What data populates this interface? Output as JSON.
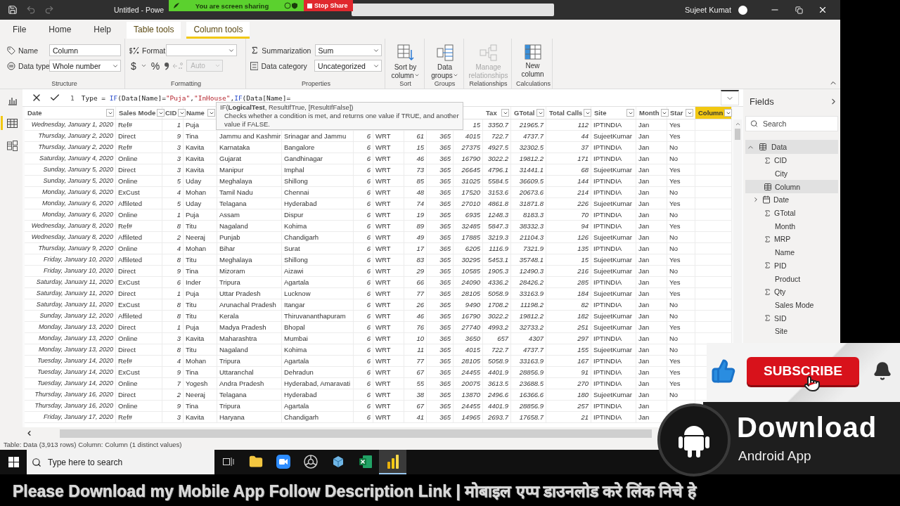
{
  "title_bar": {
    "title": "Untitled - Powe",
    "user": "Sujeet Kumat",
    "undo_disabled": true,
    "redo_disabled": true
  },
  "screen_share": {
    "status": "You are screen sharing",
    "stop_button": "Stop Share"
  },
  "ribbon_tabs": [
    {
      "label": "File",
      "selected": false,
      "kind": "plain"
    },
    {
      "label": "Home",
      "selected": false,
      "kind": "plain"
    },
    {
      "label": "Help",
      "selected": false,
      "kind": "plain"
    },
    {
      "label": "Table tools",
      "selected": false,
      "kind": "contextual"
    },
    {
      "label": "Column tools",
      "selected": true,
      "kind": "contextual"
    }
  ],
  "ribbon": {
    "structure": {
      "label": "Structure",
      "name_label": "Name",
      "name_value": "Column",
      "data_type_label": "Data type",
      "data_type_value": "Whole number"
    },
    "formatting": {
      "label": "Formatting",
      "format_label": "Format",
      "currency": "$",
      "percent": "%",
      "decimals_value": "Auto",
      "decimals_disabled": true
    },
    "properties": {
      "label": "Properties",
      "summarization_label": "Summarization",
      "summarization_value": "Sum",
      "data_category_label": "Data category",
      "data_category_value": "Uncategorized"
    },
    "sort": {
      "label": "Sort",
      "button": "Sort by column"
    },
    "groups": {
      "label": "Groups",
      "button": "Data groups"
    },
    "relationships": {
      "label": "Relationships",
      "button": "Manage relationships",
      "disabled": true
    },
    "calculations": {
      "label": "Calculations",
      "button": "New column"
    }
  },
  "view_rail": [
    {
      "kind": "report",
      "selected": false
    },
    {
      "kind": "data",
      "selected": true
    },
    {
      "kind": "model",
      "selected": false
    }
  ],
  "formula_bar": {
    "line_number": "1",
    "tokens": [
      {
        "text": "Type = ",
        "kind": "plain"
      },
      {
        "text": "IF",
        "kind": "function"
      },
      {
        "text": "(Data[Name]=",
        "kind": "plain"
      },
      {
        "text": "\"Puja\"",
        "kind": "string"
      },
      {
        "text": ",",
        "kind": "plain"
      },
      {
        "text": "\"InHouse\"",
        "kind": "string"
      },
      {
        "text": ",",
        "kind": "plain"
      },
      {
        "text": "IF",
        "kind": "function"
      },
      {
        "text": "(Data[Name]=",
        "kind": "plain"
      }
    ]
  },
  "tooltip": {
    "signature": "IF(**LogicalTest**, ResultIfTrue, [ResultIfFalse])",
    "description": "Checks whether a condition is met, and returns one value if TRUE, and another value if FALSE."
  },
  "table": {
    "columns": [
      {
        "label": "Date",
        "kind": "date",
        "selected": false
      },
      {
        "label": "Sales Mode",
        "kind": "text",
        "selected": false
      },
      {
        "label": "CID",
        "kind": "number",
        "selected": false
      },
      {
        "label": "Name",
        "kind": "text",
        "selected": false
      },
      {
        "kind": "text"
      },
      {
        "kind": "text"
      },
      {
        "kind": "number"
      },
      {
        "kind": "text"
      },
      {
        "kind": "number"
      },
      {
        "kind": "number"
      },
      {
        "kind": "number"
      },
      {
        "label": "Tax",
        "kind": "number",
        "selected": false
      },
      {
        "label": "GTotal",
        "kind": "number",
        "selected": false
      },
      {
        "label": "Total Calls",
        "kind": "number",
        "selected": false
      },
      {
        "label": "Site",
        "kind": "text",
        "selected": false
      },
      {
        "label": "Month",
        "kind": "text",
        "selected": false
      },
      {
        "label": "Star",
        "kind": "text",
        "selected": false
      },
      {
        "label": "Column",
        "kind": "text",
        "selected": true
      }
    ],
    "rows": [
      [
        "Wednesday, January 1, 2020",
        "Ref#",
        "1",
        "Puja",
        null,
        null,
        null,
        null,
        null,
        null,
        "15",
        "3350.7",
        "21965.7",
        "112",
        "IPTINDIA",
        "Jan",
        "Yes"
      ],
      [
        "Thursday, January 2, 2020",
        "Direct",
        "9",
        "Tina",
        "Jammu and Kashmir",
        "Srinagar and Jammu",
        "6",
        "WRT",
        "61",
        "365",
        "4015",
        "722.7",
        "4737.7",
        "44",
        "SujeetKumar",
        "Jan",
        "Yes"
      ],
      [
        "Thursday, January 2, 2020",
        "Ref#",
        "3",
        "Kavita",
        "Karnataka",
        "Bangalore",
        "6",
        "WRT",
        "15",
        "365",
        "27375",
        "4927.5",
        "32302.5",
        "37",
        "IPTINDIA",
        "Jan",
        "No"
      ],
      [
        "Saturday, January 4, 2020",
        "Online",
        "3",
        "Kavita",
        "Gujarat",
        "Gandhinagar",
        "6",
        "WRT",
        "46",
        "365",
        "16790",
        "3022.2",
        "19812.2",
        "171",
        "IPTINDIA",
        "Jan",
        "No"
      ],
      [
        "Sunday, January 5, 2020",
        "Direct",
        "3",
        "Kavita",
        "Manipur",
        "Imphal",
        "6",
        "WRT",
        "73",
        "365",
        "26645",
        "4796.1",
        "31441.1",
        "68",
        "SujeetKumar",
        "Jan",
        "Yes"
      ],
      [
        "Sunday, January 5, 2020",
        "Online",
        "5",
        "Uday",
        "Meghalaya",
        "Shillong",
        "6",
        "WRT",
        "85",
        "365",
        "31025",
        "5584.5",
        "36609.5",
        "144",
        "IPTINDIA",
        "Jan",
        "Yes"
      ],
      [
        "Monday, January 6, 2020",
        "ExCust",
        "4",
        "Mohan",
        "Tamil Nadu",
        "Chennai",
        "6",
        "WRT",
        "48",
        "365",
        "17520",
        "3153.6",
        "20673.6",
        "214",
        "IPTINDIA",
        "Jan",
        "No"
      ],
      [
        "Monday, January 6, 2020",
        "Affileted",
        "5",
        "Uday",
        "Telagana",
        "Hyderabad",
        "6",
        "WRT",
        "74",
        "365",
        "27010",
        "4861.8",
        "31871.8",
        "226",
        "SujeetKumar",
        "Jan",
        "Yes"
      ],
      [
        "Monday, January 6, 2020",
        "Online",
        "1",
        "Puja",
        "Assam",
        "Dispur",
        "6",
        "WRT",
        "19",
        "365",
        "6935",
        "1248.3",
        "8183.3",
        "70",
        "IPTINDIA",
        "Jan",
        "No"
      ],
      [
        "Wednesday, January 8, 2020",
        "Ref#",
        "8",
        "Titu",
        "Nagaland",
        "Kohima",
        "6",
        "WRT",
        "89",
        "365",
        "32485",
        "5847.3",
        "38332.3",
        "94",
        "IPTINDIA",
        "Jan",
        "Yes"
      ],
      [
        "Wednesday, January 8, 2020",
        "Affileted",
        "2",
        "Neeraj",
        "Punjab",
        "Chandigarh",
        "6",
        "WRT",
        "49",
        "365",
        "17885",
        "3219.3",
        "21104.3",
        "126",
        "SujeetKumar",
        "Jan",
        "No"
      ],
      [
        "Thursday, January 9, 2020",
        "Online",
        "4",
        "Mohan",
        "Bihar",
        "Surat",
        "6",
        "WRT",
        "17",
        "365",
        "6205",
        "1116.9",
        "7321.9",
        "135",
        "IPTINDIA",
        "Jan",
        "No"
      ],
      [
        "Friday, January 10, 2020",
        "Affileted",
        "8",
        "Titu",
        "Meghalaya",
        "Shillong",
        "6",
        "WRT",
        "83",
        "365",
        "30295",
        "5453.1",
        "35748.1",
        "15",
        "SujeetKumar",
        "Jan",
        "Yes"
      ],
      [
        "Friday, January 10, 2020",
        "Direct",
        "9",
        "Tina",
        "Mizoram",
        "Aizawi",
        "6",
        "WRT",
        "29",
        "365",
        "10585",
        "1905.3",
        "12490.3",
        "216",
        "SujeetKumar",
        "Jan",
        "No"
      ],
      [
        "Saturday, January 11, 2020",
        "ExCust",
        "6",
        "Inder",
        "Tripura",
        "Agartala",
        "6",
        "WRT",
        "66",
        "365",
        "24090",
        "4336.2",
        "28426.2",
        "285",
        "IPTINDIA",
        "Jan",
        "Yes"
      ],
      [
        "Saturday, January 11, 2020",
        "Direct",
        "1",
        "Puja",
        "Uttar Pradesh",
        "Lucknow",
        "6",
        "WRT",
        "77",
        "365",
        "28105",
        "5058.9",
        "33163.9",
        "184",
        "SujeetKumar",
        "Jan",
        "Yes"
      ],
      [
        "Saturday, January 11, 2020",
        "ExCust",
        "8",
        "Titu",
        "Arunachal Pradesh",
        "Itangar",
        "6",
        "WRT",
        "26",
        "365",
        "9490",
        "1708.2",
        "11198.2",
        "82",
        "IPTINDIA",
        "Jan",
        "No"
      ],
      [
        "Sunday, January 12, 2020",
        "Affileted",
        "8",
        "Titu",
        "Kerala",
        "Thiruvananthapuram",
        "6",
        "WRT",
        "46",
        "365",
        "16790",
        "3022.2",
        "19812.2",
        "182",
        "SujeetKumar",
        "Jan",
        "No"
      ],
      [
        "Monday, January 13, 2020",
        "Direct",
        "1",
        "Puja",
        "Madya Pradesh",
        "Bhopal",
        "6",
        "WRT",
        "76",
        "365",
        "27740",
        "4993.2",
        "32733.2",
        "251",
        "SujeetKumar",
        "Jan",
        "Yes"
      ],
      [
        "Monday, January 13, 2020",
        "Online",
        "3",
        "Kavita",
        "Maharashtra",
        "Mumbai",
        "6",
        "WRT",
        "10",
        "365",
        "3650",
        "657",
        "4307",
        "297",
        "IPTINDIA",
        "Jan",
        "No"
      ],
      [
        "Monday, January 13, 2020",
        "Direct",
        "8",
        "Titu",
        "Nagaland",
        "Kohima",
        "6",
        "WRT",
        "11",
        "365",
        "4015",
        "722.7",
        "4737.7",
        "155",
        "SujeetKumar",
        "Jan",
        "No"
      ],
      [
        "Tuesday, January 14, 2020",
        "Ref#",
        "4",
        "Mohan",
        "Tripura",
        "Agartala",
        "6",
        "WRT",
        "77",
        "365",
        "28105",
        "5058.9",
        "33163.9",
        "167",
        "IPTINDIA",
        "Jan",
        "Yes"
      ],
      [
        "Tuesday, January 14, 2020",
        "ExCust",
        "9",
        "Tina",
        "Uttaranchal",
        "Dehradun",
        "6",
        "WRT",
        "67",
        "365",
        "24455",
        "4401.9",
        "28856.9",
        "91",
        "IPTINDIA",
        "Jan",
        "Yes"
      ],
      [
        "Tuesday, January 14, 2020",
        "Online",
        "7",
        "Yogesh",
        "Andra Pradesh",
        "Hyderabad, Amaravati",
        "6",
        "WRT",
        "55",
        "365",
        "20075",
        "3613.5",
        "23688.5",
        "270",
        "IPTINDIA",
        "Jan",
        "Yes"
      ],
      [
        "Thursday, January 16, 2020",
        "Direct",
        "2",
        "Neeraj",
        "Telagana",
        "Hyderabad",
        "6",
        "WRT",
        "38",
        "365",
        "13870",
        "2496.6",
        "16366.6",
        "180",
        "SujeetKumar",
        "Jan",
        "No"
      ],
      [
        "Thursday, January 16, 2020",
        "Online",
        "9",
        "Tina",
        "Tripura",
        "Agartala",
        "6",
        "WRT",
        "67",
        "365",
        "24455",
        "4401.9",
        "28856.9",
        "257",
        "IPTINDIA",
        "Jan",
        null
      ],
      [
        "Friday, January 17, 2020",
        "Ref#",
        "3",
        "Kavita",
        "Haryana",
        "Chandigarh",
        "6",
        "WRT",
        "41",
        "365",
        "14965",
        "2693.7",
        "17658.7",
        "21",
        "IPTINDIA",
        "Jan",
        null
      ]
    ]
  },
  "status_bar": "Table: Data (3,913 rows) Column: Column (1 distinct values)",
  "fields_panel": {
    "title": "Fields",
    "search_placeholder": "Search",
    "tables": [
      {
        "name": "Data",
        "expanded": true,
        "children": [
          {
            "name": "CID",
            "kind": "sum",
            "selected": false
          },
          {
            "name": "City",
            "kind": "text",
            "selected": false
          },
          {
            "name": "Column",
            "kind": "calculated",
            "selected": true
          },
          {
            "name": "Date",
            "kind": "date",
            "selected": false,
            "expanded": false
          },
          {
            "name": "GTotal",
            "kind": "sum",
            "selected": false
          },
          {
            "name": "Month",
            "kind": "text",
            "selected": false
          },
          {
            "name": "MRP",
            "kind": "sum",
            "selected": false
          },
          {
            "name": "Name",
            "kind": "text",
            "selected": false
          },
          {
            "name": "PID",
            "kind": "sum",
            "selected": false
          },
          {
            "name": "Product",
            "kind": "text",
            "selected": false
          },
          {
            "name": "Qty",
            "kind": "sum",
            "selected": false
          },
          {
            "name": "Sales Mode",
            "kind": "text",
            "selected": false
          },
          {
            "name": "SID",
            "kind": "sum",
            "selected": false
          },
          {
            "name": "Site",
            "kind": "text",
            "selected": false
          }
        ]
      }
    ]
  },
  "taskbar": {
    "search_placeholder": "Type here to search",
    "apps": [
      {
        "kind": "task_view",
        "active": false
      },
      {
        "kind": "folder",
        "active": false
      },
      {
        "kind": "video",
        "active": false
      },
      {
        "kind": "browser",
        "active": false
      },
      {
        "kind": "studio",
        "active": false
      },
      {
        "kind": "spreadsheet",
        "active": false
      },
      {
        "kind": "powerbi",
        "active": true
      }
    ]
  },
  "promo": {
    "subscribe": "SUBSCRIBE",
    "download_title": "Download",
    "download_subtitle": "Android App",
    "banner": "Please Download my Mobile App Follow Description Link | मोबाइल एप्प डाउनलोड करे लिंक निचे हे"
  }
}
